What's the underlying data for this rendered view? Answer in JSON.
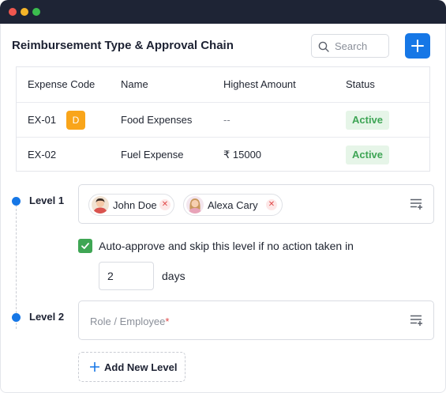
{
  "window": {
    "controls": [
      "close",
      "minimize",
      "maximize"
    ],
    "colors": {
      "close": "#f0574f",
      "minimize": "#f5b529",
      "maximize": "#3bbd4e",
      "titlebar": "#1e2435"
    }
  },
  "header": {
    "title": "Reimbursement Type & Approval Chain",
    "search_placeholder": "Search",
    "add_button_icon": "plus-icon",
    "accent_color": "#1677e6"
  },
  "table": {
    "columns": [
      "Expense Code",
      "Name",
      "Highest Amount",
      "Status"
    ],
    "rows": [
      {
        "code": "EX-01",
        "code_badge": "D",
        "name": "Food Expenses",
        "amount": "--",
        "status": "Active"
      },
      {
        "code": "EX-02",
        "code_badge": "",
        "name": "Fuel Expense",
        "amount": "₹ 15000",
        "status": "Active"
      }
    ]
  },
  "levels": [
    {
      "label": "Level 1",
      "approvers": [
        {
          "name": "John Doe",
          "avatar": "male-avatar"
        },
        {
          "name": "Alexa Cary",
          "avatar": "female-avatar"
        }
      ],
      "auto_approve": {
        "checked": true,
        "text": "Auto-approve and skip this level if no action taken in",
        "days_value": "2",
        "days_label": "days"
      }
    },
    {
      "label": "Level 2",
      "placeholder": "Role / Employee",
      "required_marker": "*"
    }
  ],
  "actions": {
    "add_level_label": "Add New Level"
  }
}
